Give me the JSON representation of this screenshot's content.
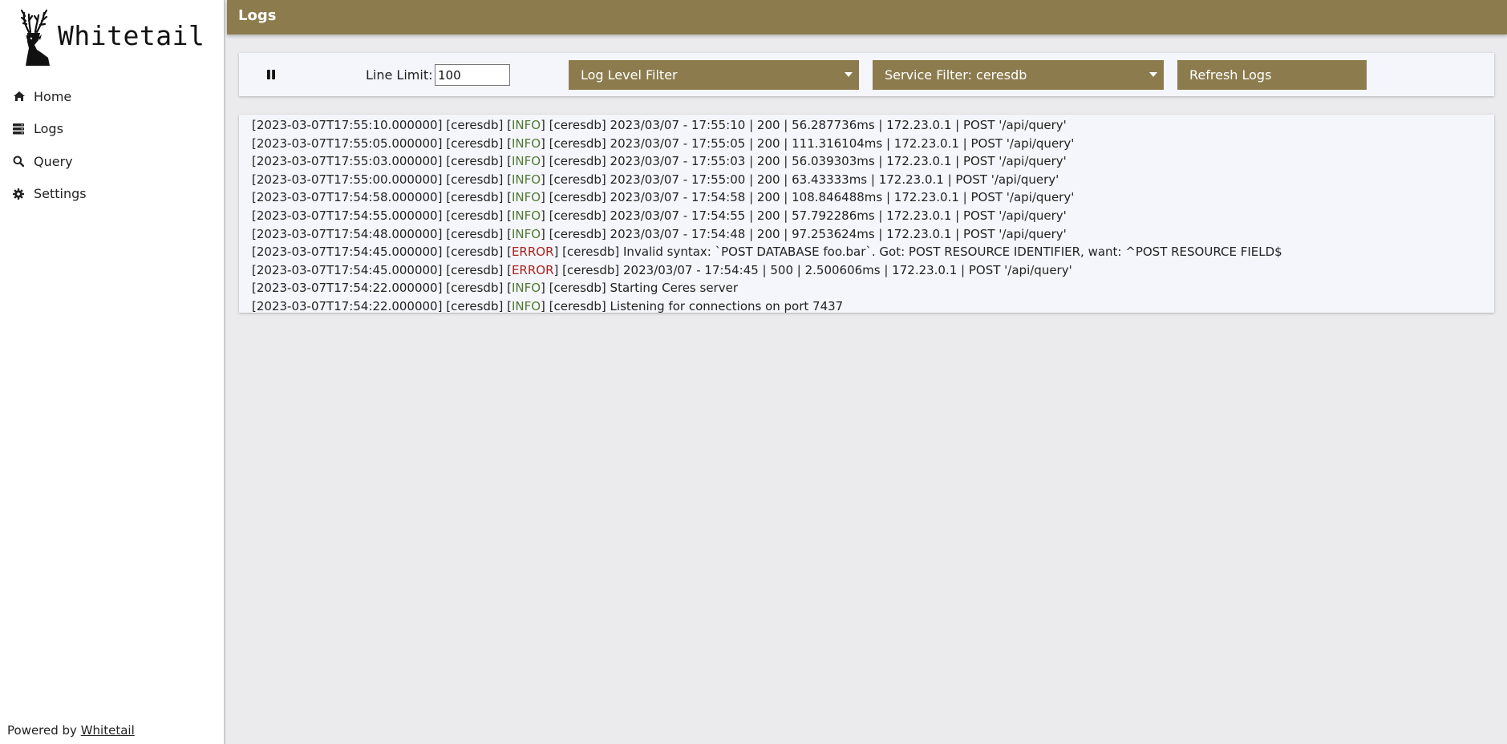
{
  "app": {
    "name": "Whitetail"
  },
  "sidebar": {
    "items": [
      {
        "label": "Home",
        "icon": "home-icon"
      },
      {
        "label": "Logs",
        "icon": "logs-icon"
      },
      {
        "label": "Query",
        "icon": "search-icon"
      },
      {
        "label": "Settings",
        "icon": "gear-icon"
      }
    ],
    "footer": {
      "prefix": "Powered by ",
      "link_text": "Whitetail"
    }
  },
  "header": {
    "title": "Logs"
  },
  "toolbar": {
    "pause_icon": "pause-icon",
    "line_limit_label": "Line Limit:",
    "line_limit_value": "100",
    "log_level_filter": "Log Level Filter",
    "service_filter": "Service Filter: ceresdb",
    "refresh_label": "Refresh Logs"
  },
  "colors": {
    "accent": "#8c7b4d",
    "info": "#4e7a30",
    "error": "#a8231c"
  },
  "logs": [
    {
      "timestamp": "[2023-03-07T17:55:10.000000]",
      "service": "[ceresdb]",
      "level": "INFO",
      "message": "[ceresdb] 2023/03/07 - 17:55:10 | 200 | 56.287736ms | 172.23.0.1 | POST '/api/query'"
    },
    {
      "timestamp": "[2023-03-07T17:55:05.000000]",
      "service": "[ceresdb]",
      "level": "INFO",
      "message": "[ceresdb] 2023/03/07 - 17:55:05 | 200 | 111.316104ms | 172.23.0.1 | POST '/api/query'"
    },
    {
      "timestamp": "[2023-03-07T17:55:03.000000]",
      "service": "[ceresdb]",
      "level": "INFO",
      "message": "[ceresdb] 2023/03/07 - 17:55:03 | 200 | 56.039303ms | 172.23.0.1 | POST '/api/query'"
    },
    {
      "timestamp": "[2023-03-07T17:55:00.000000]",
      "service": "[ceresdb]",
      "level": "INFO",
      "message": "[ceresdb] 2023/03/07 - 17:55:00 | 200 | 63.43333ms | 172.23.0.1 | POST '/api/query'"
    },
    {
      "timestamp": "[2023-03-07T17:54:58.000000]",
      "service": "[ceresdb]",
      "level": "INFO",
      "message": "[ceresdb] 2023/03/07 - 17:54:58 | 200 | 108.846488ms | 172.23.0.1 | POST '/api/query'"
    },
    {
      "timestamp": "[2023-03-07T17:54:55.000000]",
      "service": "[ceresdb]",
      "level": "INFO",
      "message": "[ceresdb] 2023/03/07 - 17:54:55 | 200 | 57.792286ms | 172.23.0.1 | POST '/api/query'"
    },
    {
      "timestamp": "[2023-03-07T17:54:48.000000]",
      "service": "[ceresdb]",
      "level": "INFO",
      "message": "[ceresdb] 2023/03/07 - 17:54:48 | 200 | 97.253624ms | 172.23.0.1 | POST '/api/query'"
    },
    {
      "timestamp": "[2023-03-07T17:54:45.000000]",
      "service": "[ceresdb]",
      "level": "ERROR",
      "message": "[ceresdb] Invalid syntax: `POST DATABASE foo.bar`. Got: POST RESOURCE IDENTIFIER, want: ^POST RESOURCE FIELD$"
    },
    {
      "timestamp": "[2023-03-07T17:54:45.000000]",
      "service": "[ceresdb]",
      "level": "ERROR",
      "message": "[ceresdb] 2023/03/07 - 17:54:45 | 500 | 2.500606ms | 172.23.0.1 | POST '/api/query'"
    },
    {
      "timestamp": "[2023-03-07T17:54:22.000000]",
      "service": "[ceresdb]",
      "level": "INFO",
      "message": "[ceresdb] Starting Ceres server"
    },
    {
      "timestamp": "[2023-03-07T17:54:22.000000]",
      "service": "[ceresdb]",
      "level": "INFO",
      "message": "[ceresdb] Listening for connections on port 7437"
    }
  ]
}
